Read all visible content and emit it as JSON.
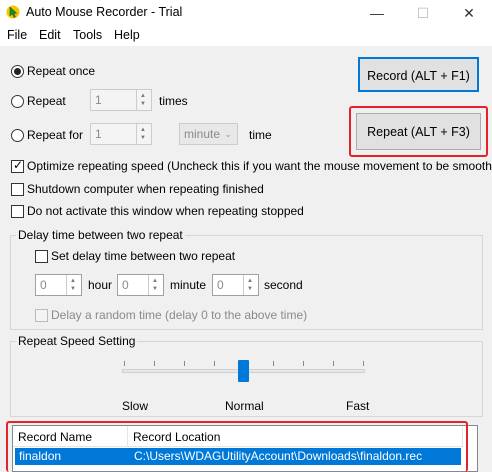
{
  "window": {
    "title": "Auto Mouse Recorder - Trial",
    "minimize": "—",
    "maximize": "☐",
    "close": "✕"
  },
  "menu": [
    "File",
    "Edit",
    "Tools",
    "Help"
  ],
  "repeat": {
    "once_label": "Repeat once",
    "repeat_label": "Repeat",
    "repeat_count": "1",
    "times_label": "times",
    "repeat_for_label": "Repeat for",
    "repeat_for_value": "1",
    "unit_selected": "minute",
    "time_label": "time",
    "selected": "once"
  },
  "buttons": {
    "record": "Record (ALT + F1)",
    "repeat": "Repeat (ALT + F3)"
  },
  "options": {
    "optimize": {
      "label": "Optimize repeating speed (Uncheck this if you want the mouse movement to be smoother)",
      "checked": true
    },
    "shutdown": {
      "label": "Shutdown computer when repeating finished",
      "checked": false
    },
    "no_activate": {
      "label": "Do not activate this window when repeating stopped",
      "checked": false
    }
  },
  "delay": {
    "group_title": "Delay time between two repeat",
    "set_delay_label": "Set delay time between two repeat",
    "hour_value": "0",
    "hour_label": "hour",
    "minute_value": "0",
    "minute_label": "minute",
    "second_value": "0",
    "second_label": "second",
    "random_label": "Delay a random time (delay 0 to the above time)"
  },
  "speed": {
    "group_title": "Repeat Speed Setting",
    "slow": "Slow",
    "normal": "Normal",
    "fast": "Fast",
    "level": 0.5
  },
  "list": {
    "headers": [
      "Record Name",
      "Record Location"
    ],
    "rows": [
      {
        "name": "finaldon",
        "location": "C:\\Users\\WDAGUtilityAccount\\Downloads\\finaldon.rec",
        "selected": true
      }
    ]
  },
  "colors": {
    "accent": "#0078d7",
    "highlight": "#e3242b"
  },
  "icons": {
    "app": "mouse-cursor-icon"
  }
}
